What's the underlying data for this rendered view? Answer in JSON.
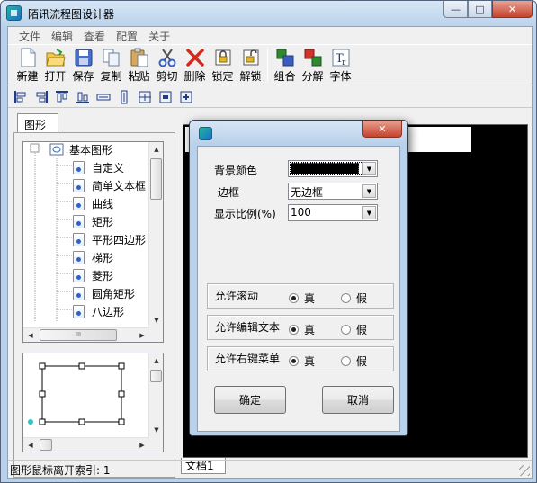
{
  "window": {
    "title": "陌讯流程图设计器",
    "controls": {
      "minimize": "—",
      "maximize": "□",
      "close": "✕"
    }
  },
  "menu": [
    "文件",
    "编辑",
    "查看",
    "配置",
    "关于"
  ],
  "toolbar": [
    {
      "label": "新建",
      "icon": "new-file-icon"
    },
    {
      "label": "打开",
      "icon": "open-folder-icon"
    },
    {
      "label": "保存",
      "icon": "save-disk-icon"
    },
    {
      "label": "复制",
      "icon": "copy-icon"
    },
    {
      "label": "粘贴",
      "icon": "paste-icon"
    },
    {
      "label": "剪切",
      "icon": "scissors-icon"
    },
    {
      "label": "删除",
      "icon": "delete-x-icon"
    },
    {
      "label": "锁定",
      "icon": "lock-icon"
    },
    {
      "label": "解锁",
      "icon": "unlock-icon"
    },
    {
      "label": "组合",
      "icon": "group-icon"
    },
    {
      "label": "分解",
      "icon": "ungroup-icon"
    },
    {
      "label": "字体",
      "icon": "font-icon"
    }
  ],
  "align_toolbar": [
    "align-left-icon",
    "align-right-icon",
    "align-top-icon",
    "align-bottom-icon",
    "same-width-icon",
    "same-height-icon",
    "center-horizontal-icon",
    "center-vertical-icon",
    "same-size-icon"
  ],
  "left_panel": {
    "tab": "图形",
    "tree_root": "基本图形",
    "tree_items": [
      "自定义",
      "简单文本框",
      "曲线",
      "矩形",
      "平形四边形",
      "梯形",
      "菱形",
      "圆角矩形",
      "八边形"
    ],
    "hscroll_grip": "III"
  },
  "document_tab": "文档1",
  "status": {
    "text": "图形鼠标离开索引: 1"
  },
  "dialog": {
    "background_color_label": "背景颜色",
    "background_color_value": "#000000",
    "border_label": "边框",
    "border_value": "无边框",
    "scale_label": "显示比例(%)",
    "scale_value": "100",
    "options": [
      {
        "label": "允许滚动",
        "yes": "真",
        "no": "假",
        "selected": "yes"
      },
      {
        "label": "允许编辑文本",
        "yes": "真",
        "no": "假",
        "selected": "yes"
      },
      {
        "label": "允许右键菜单",
        "yes": "真",
        "no": "假",
        "selected": "yes"
      }
    ],
    "ok": "确定",
    "cancel": "取消",
    "close": "✕"
  }
}
